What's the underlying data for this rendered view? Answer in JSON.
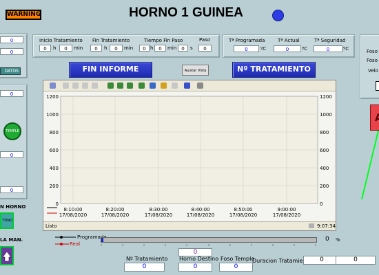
{
  "header": {
    "warning_label": "WARNING",
    "title": "HORNO 1 GUINEA"
  },
  "times": {
    "inicio_label": "Inicio Tratamiento",
    "fin_label": "Fin Tratamiento",
    "fin_paso_label": "Tiempo Fin Paso",
    "paso_label": "Paso",
    "inicio_h": "0",
    "inicio_min": "0",
    "fin_h": "0",
    "fin_min": "0",
    "finpaso_h": "0",
    "finpaso_min": "0",
    "finpaso_s": "0",
    "paso": "0",
    "unit_h": "h",
    "unit_min": "min",
    "unit_s": "s"
  },
  "temps": {
    "programada_label": "Tª Programada",
    "actual_label": "Tª Actual",
    "seguridad_label": "Tª Seguridad",
    "programada": "0",
    "actual": "0",
    "seguridad": "0",
    "unit": "ºC"
  },
  "right_partial": {
    "foso1": "Foso",
    "foso2": "Foso",
    "velo": "Velo",
    "alarm_letter": "A"
  },
  "buttons": {
    "fin_informe": "FIN INFORME",
    "ajustar_vista": "Ajustar Vista",
    "n_tratamiento": "Nº TRATAMIENTO"
  },
  "left_partial": {
    "v1": "0",
    "v2": "0",
    "datos": "DATOS",
    "v3": "0",
    "temple": "TEMPLE",
    "v4": "0",
    "v5": "0",
    "v6": "0",
    "horno": "N HORNO",
    "tono": "TONO",
    "man": "LA MAN."
  },
  "chart_data": {
    "type": "line",
    "y_ticks": [
      "1200",
      "1000",
      "800",
      "600",
      "400",
      "200",
      "0"
    ],
    "ylim": [
      0,
      1200
    ],
    "x_ticks": [
      {
        "time": "8:10:00",
        "date": "17/08/2020"
      },
      {
        "time": "8:20:00",
        "date": "17/08/2020"
      },
      {
        "time": "8:30:00",
        "date": "17/08/2020"
      },
      {
        "time": "8:40:00",
        "date": "17/08/2020"
      },
      {
        "time": "8:50:00",
        "date": "17/08/2020"
      },
      {
        "time": "9:00:00",
        "date": "17/08/2020"
      }
    ],
    "series": [
      {
        "name": "Programada",
        "color": "#000000",
        "values": []
      },
      {
        "name": "Real",
        "color": "#cc0000",
        "values": []
      }
    ],
    "grid": true
  },
  "chart_status": {
    "left": "Listo",
    "time": "9:07:34"
  },
  "legend": {
    "programada": "Programada",
    "real": "Real"
  },
  "progress": {
    "value": 0,
    "percent_value": "0",
    "percent_sign": "%"
  },
  "bottom": {
    "n_tratamiento_label": "Nº Tratamiento",
    "n_tratamiento": "0",
    "horno_destino_label": "Horno Destino",
    "horno_destino": "0",
    "horno_destino_top": "0",
    "foso_temple_label": "Foso Temple",
    "foso_temple": "0",
    "duracion_label": "Duracion Tratamiento",
    "duracion_1": "0",
    "duracion_2": "0"
  },
  "colors": {
    "background": "#b9ced3",
    "button_blue": "#2433c4",
    "warning_orange": "#ff7f00",
    "status_dot": "#2e3ce8"
  }
}
